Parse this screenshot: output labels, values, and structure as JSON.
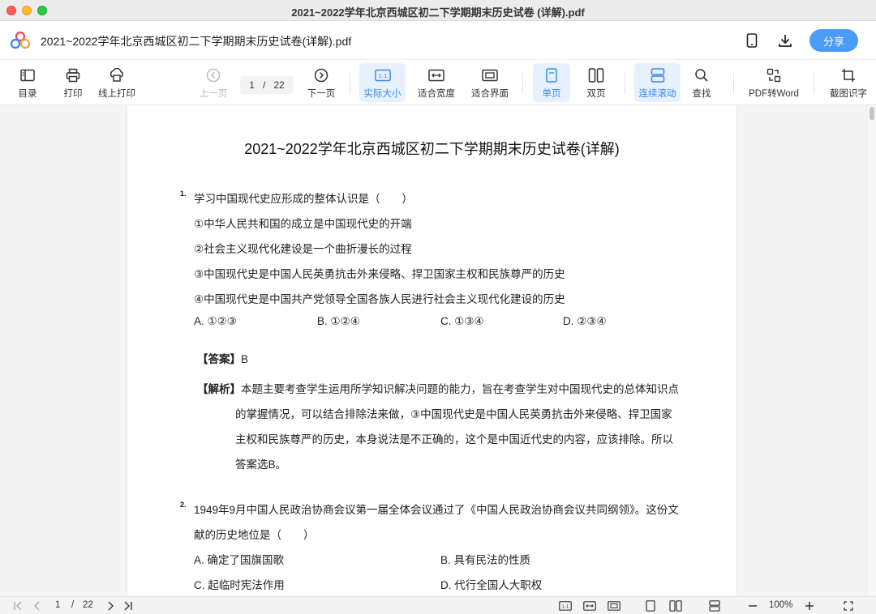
{
  "window": {
    "title": "2021~2022学年北京西城区初二下学期期末历史试卷 (详解).pdf"
  },
  "header": {
    "doc_title": "2021~2022学年北京西城区初二下学期期末历史试卷(详解).pdf",
    "share_label": "分享"
  },
  "toolbar": {
    "toc": "目录",
    "print": "打印",
    "online_print": "线上打印",
    "prev_page": "上一页",
    "next_page": "下一页",
    "current_page": "1",
    "page_sep": "/",
    "total_pages": "22",
    "actual_size": "实际大小",
    "fit_width": "适合宽度",
    "fit_window": "适合界面",
    "single_page": "单页",
    "double_page": "双页",
    "continuous_scroll": "连续滚动",
    "find": "查找",
    "pdf_to_word": "PDF转Word",
    "screenshot_ocr": "截图识字"
  },
  "document": {
    "title": "2021~2022学年北京西城区初二下学期期末历史试卷(详解)",
    "q1": {
      "number": "1.",
      "stem": "学习中国现代史应形成的整体认识是（　　）",
      "statements": [
        "①中华人民共和国的成立是中国现代史的开端",
        "②社会主义现代化建设是一个曲折漫长的过程",
        "③中国现代史是中国人民英勇抗击外来侵略、捍卫国家主权和民族尊严的历史",
        "④中国现代史是中国共产党领导全国各族人民进行社会主义现代化建设的历史"
      ],
      "options": [
        "A. ①②③",
        "B. ①②④",
        "C. ①③④",
        "D. ②③④"
      ],
      "answer_label": "【答案】",
      "answer_value": "B",
      "analysis_label": "【解析】",
      "analysis_lines": [
        "本题主要考查学生运用所学知识解决问题的能力，旨在考查学生对中国现代史的总体知识点",
        "的掌握情况，可以结合排除法来做，③中国现代史是中国人民英勇抗击外来侵略、捍卫国家",
        "主权和民族尊严的历史，本身说法是不正确的，这个是中国近代史的内容，应该排除。所以",
        "答案选B。"
      ]
    },
    "q2": {
      "number": "2.",
      "stem_lines": [
        "1949年9月中国人民政治协商会议第一届全体会议通过了《中国人民政治协商会议共同纲领》。这份文",
        "献的历史地位是（　　）"
      ],
      "options": [
        "A. 确定了国旗国歌",
        "B. 具有民法的性质",
        "C. 起临时宪法作用",
        "D. 代行全国人大职权"
      ]
    }
  },
  "statusbar": {
    "current_page": "1",
    "page_sep": "/",
    "total_pages": "22",
    "zoom": "100%"
  },
  "colors": {
    "accent": "#4a9cf5",
    "active_bg": "#e7f1fd",
    "active_text": "#3b87e8"
  }
}
